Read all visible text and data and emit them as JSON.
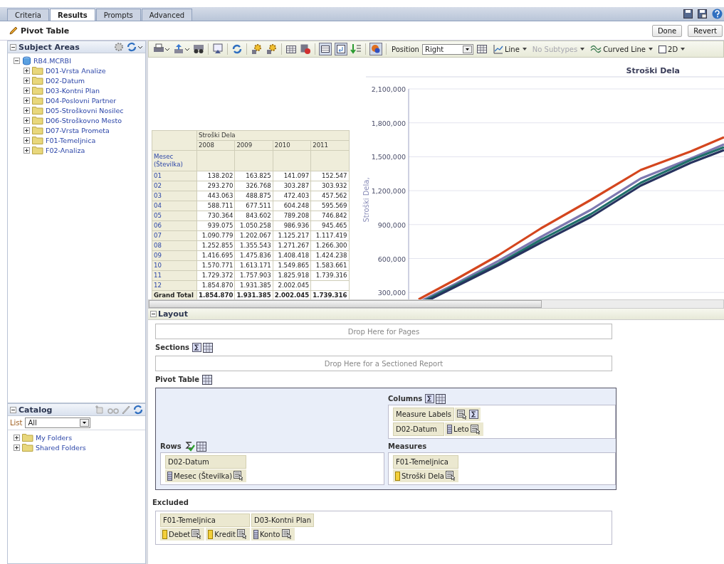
{
  "tabs": [
    {
      "label": "Criteria",
      "selected": false
    },
    {
      "label": "Results",
      "selected": true
    },
    {
      "label": "Prompts",
      "selected": false
    },
    {
      "label": "Advanced",
      "selected": false
    }
  ],
  "editor": {
    "title": "Pivot Table",
    "buttons": [
      "Done",
      "Revert"
    ]
  },
  "subject_areas": {
    "title": "Subject Areas",
    "root": {
      "label": "RB4.MCRBI",
      "expanded": true,
      "children": [
        {
          "label": "D01-Vrsta Analize",
          "expanded": false
        },
        {
          "label": "D02-Datum",
          "expanded": false
        },
        {
          "label": "D03-Kontni Plan",
          "expanded": false
        },
        {
          "label": "D04-Poslovni Partner",
          "expanded": false
        },
        {
          "label": "D05-Stroškovni Nosilec",
          "expanded": false
        },
        {
          "label": "D06-Stroškovno Mesto",
          "expanded": false
        },
        {
          "label": "D07-Vrsta Prometa",
          "expanded": false
        },
        {
          "label": "F01-Temeljnica",
          "expanded": false
        },
        {
          "label": "F02-Analiza",
          "expanded": false
        }
      ]
    }
  },
  "catalog": {
    "title": "Catalog",
    "list_label": "List",
    "list_value": "All",
    "items": [
      {
        "label": "My Folders",
        "expanded": false
      },
      {
        "label": "Shared Folders",
        "expanded": false
      }
    ]
  },
  "toolbar": {
    "position_label": "Position",
    "position_value": "Right",
    "graph_type": "Line",
    "subtype": "No Subtypes",
    "subtype_disabled": true,
    "line_style": "Curved Line",
    "dimension": "2D"
  },
  "pivot_preview": {
    "measure": "Stroški Dela",
    "years": [
      "2008",
      "2009",
      "2010",
      "2011"
    ],
    "row_header": "Mesec (Številka)",
    "rows": [
      {
        "label": "01",
        "cells": [
          "138.202",
          "163.825",
          "141.097",
          "152.547"
        ]
      },
      {
        "label": "02",
        "cells": [
          "293.270",
          "326.768",
          "303.287",
          "303.932"
        ]
      },
      {
        "label": "03",
        "cells": [
          "443.063",
          "488.875",
          "472.403",
          "457.562"
        ]
      },
      {
        "label": "04",
        "cells": [
          "588.711",
          "677.511",
          "604.248",
          "595.569"
        ]
      },
      {
        "label": "05",
        "cells": [
          "730.364",
          "843.602",
          "789.208",
          "746.842"
        ]
      },
      {
        "label": "06",
        "cells": [
          "939.075",
          "1.050.258",
          "986.936",
          "945.465"
        ]
      },
      {
        "label": "07",
        "cells": [
          "1.090.779",
          "1.202.067",
          "1.125.217",
          "1.117.419"
        ]
      },
      {
        "label": "08",
        "cells": [
          "1.252.855",
          "1.355.543",
          "1.271.267",
          "1.266.300"
        ]
      },
      {
        "label": "09",
        "cells": [
          "1.416.695",
          "1.475.836",
          "1.408.418",
          "1.424.238"
        ]
      },
      {
        "label": "10",
        "cells": [
          "1.570.771",
          "1.613.171",
          "1.549.865",
          "1.583.661"
        ]
      },
      {
        "label": "11",
        "cells": [
          "1.729.372",
          "1.757.903",
          "1.825.918",
          "1.739.316"
        ]
      },
      {
        "label": "12",
        "cells": [
          "1.854.870",
          "1.931.385",
          "2.002.045",
          null
        ]
      }
    ],
    "total": {
      "label": "Grand Total",
      "cells": [
        "1.854.870",
        "1.931.385",
        "2.002.045",
        "1.739.316"
      ]
    }
  },
  "chart": {
    "title": "Stroški Dela",
    "axis_label": "Stroški Dela,",
    "y_ticks": [
      "2,100,000",
      "1,800,000",
      "1,500,000",
      "1,200,000",
      "900,000",
      "600,000",
      "300,000"
    ]
  },
  "layout": {
    "title": "Layout",
    "pages_drop": "Drop Here for Pages",
    "sections_label": "Sections",
    "sections_drop": "Drop Here for a Sectioned Report",
    "pivot_label": "Pivot Table",
    "columns": {
      "label": "Columns",
      "groups": [
        {
          "header": "Measure Labels"
        },
        {
          "header": "D02-Datum",
          "chips": [
            {
              "label": "Leto",
              "kind": "attribute"
            }
          ]
        }
      ]
    },
    "rows": {
      "label": "Rows",
      "groups": [
        {
          "header": "D02-Datum",
          "chips": [
            {
              "label": "Mesec (Številka)",
              "kind": "attribute"
            }
          ]
        }
      ]
    },
    "measures": {
      "label": "Measures",
      "groups": [
        {
          "header": "F01-Temeljnica",
          "chips": [
            {
              "label": "Stroški Dela",
              "kind": "measure"
            }
          ]
        }
      ]
    },
    "excluded": {
      "label": "Excluded",
      "groups": [
        {
          "header": "F01-Temeljnica",
          "chips": [
            {
              "label": "Debet",
              "kind": "measure"
            },
            {
              "label": "Kredit",
              "kind": "measure"
            }
          ]
        },
        {
          "header": "D03-Kontni Plan",
          "chips": [
            {
              "label": "Konto",
              "kind": "attribute"
            }
          ]
        }
      ]
    }
  }
}
